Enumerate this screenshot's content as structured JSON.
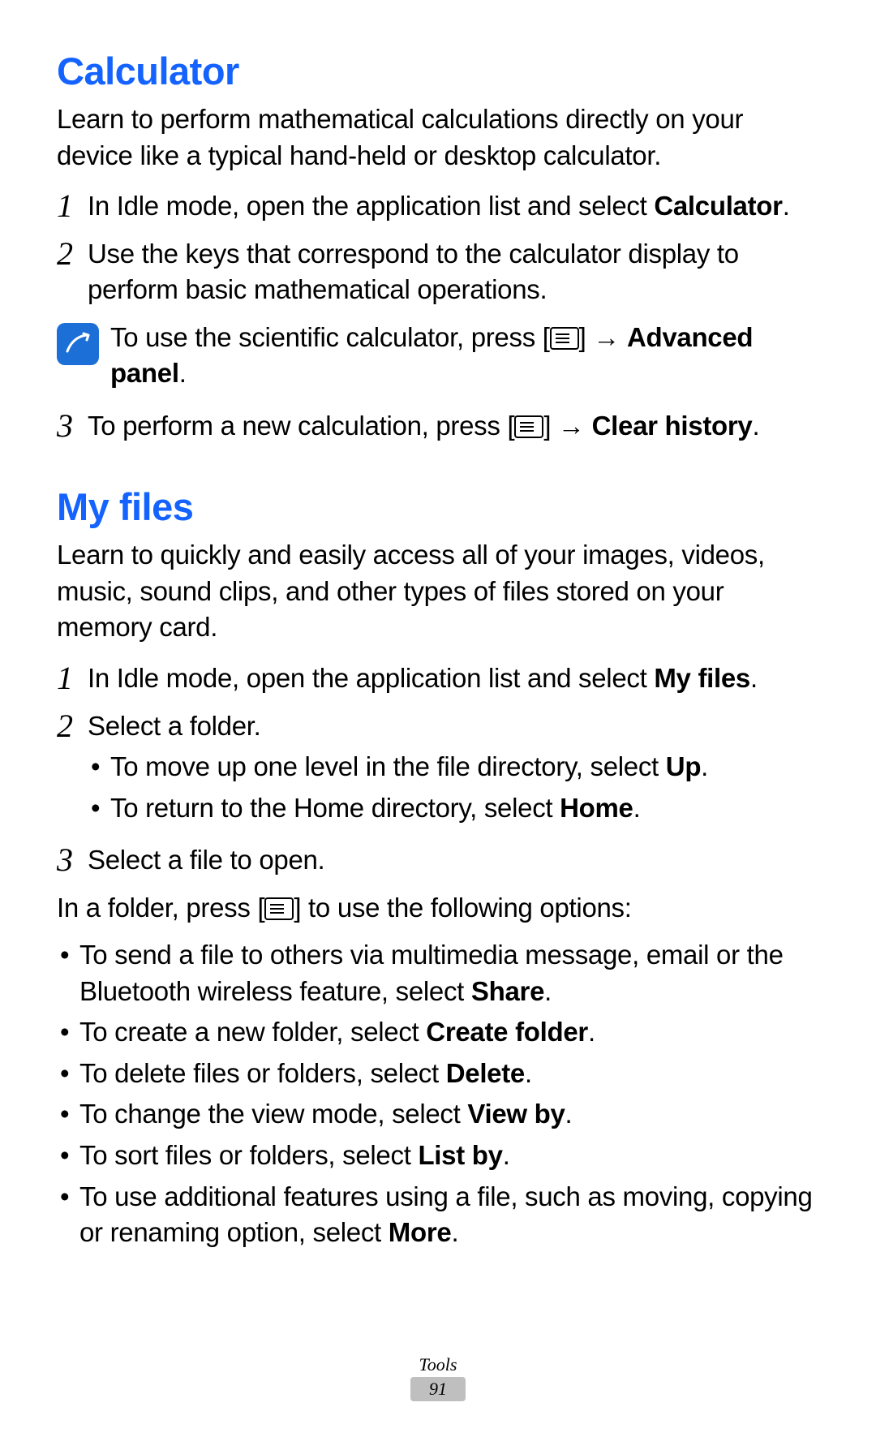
{
  "footer": {
    "section_label": "Tools",
    "page_number": "91"
  },
  "calculator": {
    "heading": "Calculator",
    "intro": "Learn to perform mathematical calculations directly on your device like a typical hand-held or desktop calculator.",
    "steps": [
      {
        "num": "1",
        "pre": "In Idle mode, open the application list and select ",
        "bold": "Calculator",
        "post": "."
      },
      {
        "num": "2",
        "text": "Use the keys that correspond to the calculator display to perform basic mathematical operations."
      }
    ],
    "note": {
      "pre": "To use the scientific calculator, press [",
      "mid": "] → ",
      "bold": "Advanced panel",
      "post": "."
    },
    "step3": {
      "num": "3",
      "pre": "To perform a new calculation, press [",
      "mid": "] → ",
      "bold": "Clear history",
      "post": "."
    }
  },
  "myfiles": {
    "heading": "My files",
    "intro": "Learn to quickly and easily access all of your images, videos, music, sound clips, and other types of files stored on your memory card.",
    "steps": {
      "s1": {
        "num": "1",
        "pre": "In Idle mode, open the application list and select ",
        "bold": "My files",
        "post": "."
      },
      "s2": {
        "num": "2",
        "text": "Select a folder.",
        "sub": [
          {
            "pre": "To move up one level in the file directory, select ",
            "bold": "Up",
            "post": "."
          },
          {
            "pre": "To return to the Home directory, select ",
            "bold": "Home",
            "post": "."
          }
        ]
      },
      "s3": {
        "num": "3",
        "text": "Select a file to open."
      }
    },
    "post_steps": {
      "pre": "In a folder, press [",
      "post": "] to use the following options:"
    },
    "options": [
      {
        "pre": "To send a file to others via multimedia message, email or the Bluetooth wireless feature, select ",
        "bold": "Share",
        "post": "."
      },
      {
        "pre": "To create a new folder, select ",
        "bold": "Create folder",
        "post": "."
      },
      {
        "pre": "To delete files or folders, select ",
        "bold": "Delete",
        "post": "."
      },
      {
        "pre": "To change the view mode, select ",
        "bold": "View by",
        "post": "."
      },
      {
        "pre": "To sort files or folders, select ",
        "bold": "List by",
        "post": "."
      },
      {
        "pre": "To use additional features using a file, such as moving, copying or renaming option, select ",
        "bold": "More",
        "post": "."
      }
    ]
  }
}
